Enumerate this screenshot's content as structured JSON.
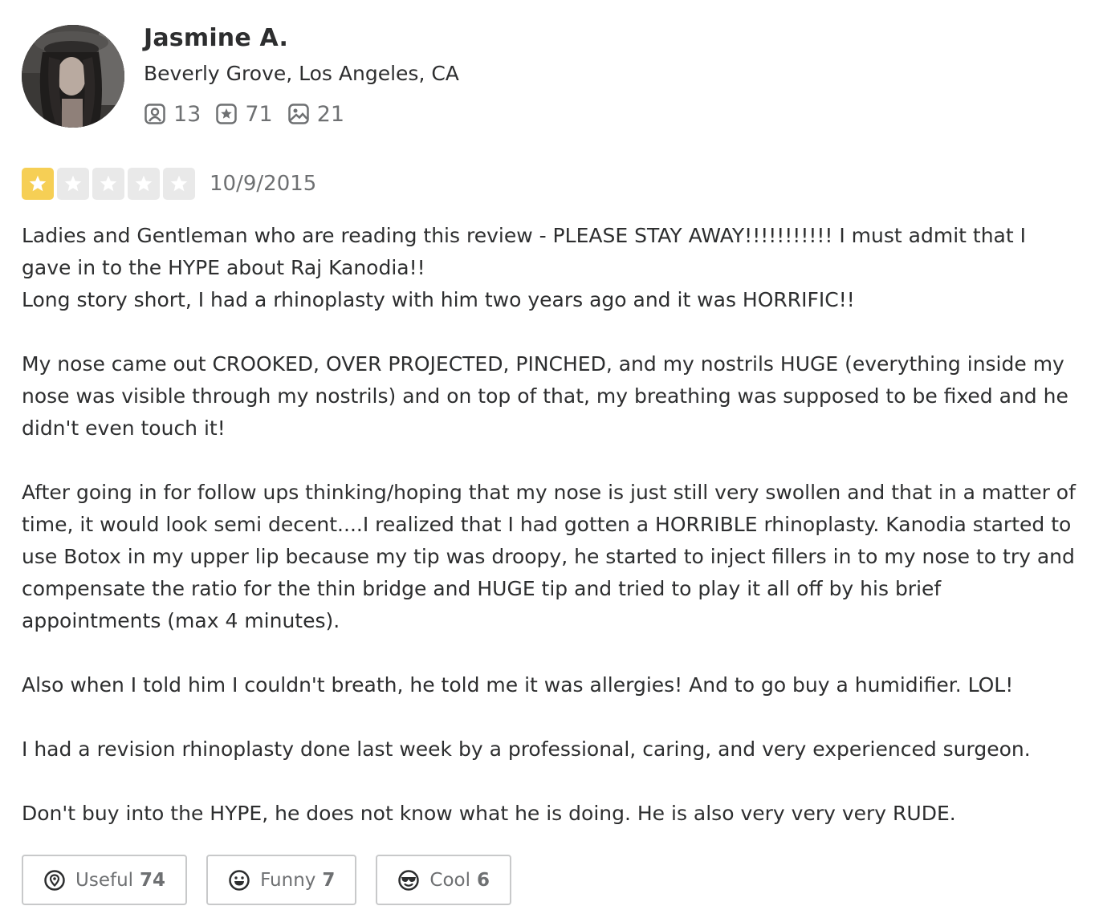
{
  "user": {
    "name": "Jasmine A.",
    "location": "Beverly Grove, Los Angeles, CA",
    "stats": [
      {
        "icon": "friends-icon",
        "value": "13"
      },
      {
        "icon": "reviews-icon",
        "value": "71"
      },
      {
        "icon": "photos-icon",
        "value": "21"
      }
    ]
  },
  "review": {
    "rating": 1,
    "rating_max": 5,
    "date": "10/9/2015",
    "text": "Ladies and Gentleman who are reading this review - PLEASE STAY AWAY!!!!!!!!!!! I must admit that I gave in to the HYPE about Raj Kanodia!!\nLong story short, I had a rhinoplasty with him two years ago and it was HORRIFIC!!\n\nMy nose came out CROOKED, OVER PROJECTED, PINCHED, and my nostrils HUGE (everything inside my nose was visible through my nostrils) and on top of that, my breathing was supposed to be fixed and he didn't even touch it!\n\nAfter going in for follow ups thinking/hoping that my nose is just still very swollen and that in a matter of time, it would look semi decent....I realized that I had gotten a HORRIBLE rhinoplasty. Kanodia started to use Botox in my upper lip because my tip was droopy, he started to inject fillers in to my nose to try and compensate the ratio for the thin bridge and HUGE tip and tried to play it all off by his brief appointments (max 4 minutes).\n\nAlso when I told him I couldn't breath, he told me it was allergies! And to go buy a humidifier. LOL!\n\nI had a revision rhinoplasty done last week by a professional, caring, and very experienced surgeon.\n\nDon't buy into the HYPE, he does not know what he is doing. He is also very very very RUDE."
  },
  "reactions": [
    {
      "icon": "useful-icon",
      "label": "Useful",
      "count": "74"
    },
    {
      "icon": "funny-icon",
      "label": "Funny",
      "count": "7"
    },
    {
      "icon": "cool-icon",
      "label": "Cool",
      "count": "6"
    }
  ],
  "colors": {
    "star_active": "#f6cf55",
    "star_inactive": "#e9e9e9",
    "text": "#2d2e2f",
    "muted": "#6e7072",
    "border": "#c8c9ca"
  }
}
